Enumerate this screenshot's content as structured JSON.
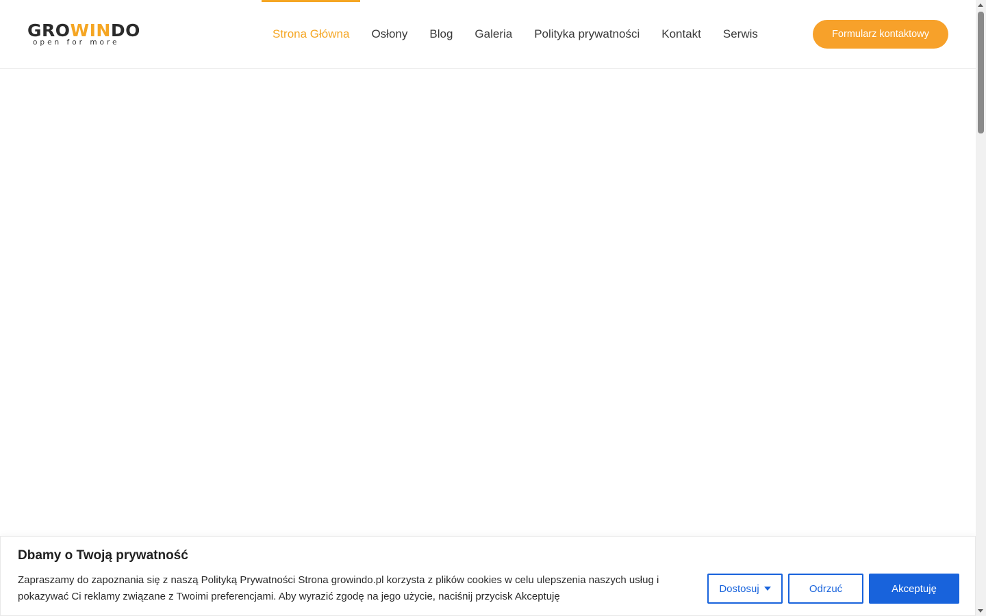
{
  "header": {
    "logo": {
      "word_left": "GRO",
      "word_accent": "WIN",
      "word_right": "DO",
      "tagline": "open for more"
    },
    "nav": [
      {
        "label": "Strona Główna",
        "active": true
      },
      {
        "label": "Osłony",
        "active": false
      },
      {
        "label": "Blog",
        "active": false
      },
      {
        "label": "Galeria",
        "active": false
      },
      {
        "label": "Polityka prywatności",
        "active": false
      },
      {
        "label": "Kontakt",
        "active": false
      },
      {
        "label": "Serwis",
        "active": false
      }
    ],
    "cta_label": "Formularz kontaktowy"
  },
  "cookie": {
    "title": "Dbamy o Twoją prywatność",
    "text": "Zapraszamy do zapoznania się z naszą Polityką Prywatności Strona growindo.pl korzysta z plików cookies w celu ulepszenia naszych usług i pokazywać Ci reklamy związane z Twoimi preferencjami. Aby wyrazić zgodę na jego użycie, naciśnij przycisk Akceptuję",
    "customize_label": "Dostosuj",
    "reject_label": "Odrzuć",
    "accept_label": "Akceptuję"
  },
  "colors": {
    "accent": "#f5a623",
    "primary_blue": "#1863dc"
  },
  "icons": {
    "customize": "caret-down-icon"
  }
}
